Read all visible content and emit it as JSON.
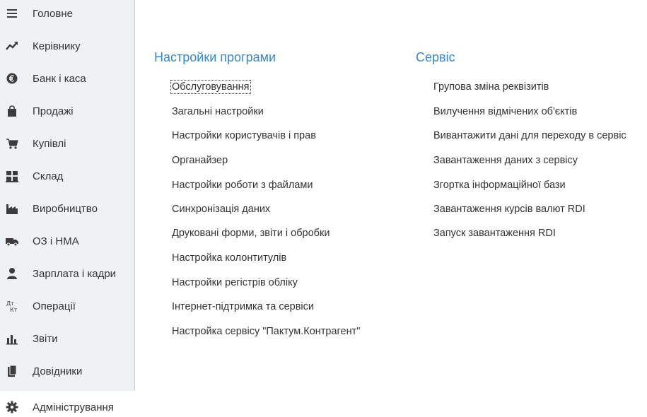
{
  "sidebar": {
    "items": [
      {
        "label": "Головне",
        "icon": "menu-lines-icon"
      },
      {
        "label": "Керівнику",
        "icon": "trend-chart-icon"
      },
      {
        "label": "Банк і каса",
        "icon": "currency-coin-icon"
      },
      {
        "label": "Продажі",
        "icon": "shopping-bag-icon"
      },
      {
        "label": "Купівлі",
        "icon": "shopping-cart-icon"
      },
      {
        "label": "Склад",
        "icon": "warehouse-grid-icon"
      },
      {
        "label": "Виробництво",
        "icon": "factory-icon"
      },
      {
        "label": "ОЗ і НМА",
        "icon": "truck-icon"
      },
      {
        "label": "Зарплата і кадри",
        "icon": "person-icon"
      },
      {
        "label": "Операції",
        "icon": "debit-credit-icon"
      },
      {
        "label": "Звіти",
        "icon": "bar-chart-icon"
      },
      {
        "label": "Довідники",
        "icon": "book-icon"
      },
      {
        "label": "Адміністрування",
        "icon": "gear-icon",
        "active": true
      }
    ]
  },
  "main": {
    "settings_section": {
      "title": "Настройки програми",
      "links": [
        "Обслуговування",
        "Загальні настройки",
        "Настройки користувачів і прав",
        "Органайзер",
        "Настройки роботи з файлами",
        "Синхронізація даних",
        "Друковані форми, звіти і обробки",
        "Настройка колонтитулів",
        "Настройки регістрів обліку",
        "Інтернет-підтримка та сервіси",
        "Настройка сервісу \"Пактум.Контрагент\""
      ]
    },
    "service_section": {
      "title": "Сервіс",
      "links": [
        "Групова зміна реквізитів",
        "Вилучення відмічених об'єктів",
        "Вивантажити дані для переходу в сервіс",
        "Завантаження даних з сервісу",
        "Згортка інформаційної бази",
        "Завантаження курсів валют RDI",
        "Запуск завантаження RDI"
      ]
    }
  },
  "colors": {
    "sidebar_bg": "#eef2f4",
    "section_title": "#3a87c6",
    "text": "#333333",
    "icon": "#3c3c3c"
  }
}
